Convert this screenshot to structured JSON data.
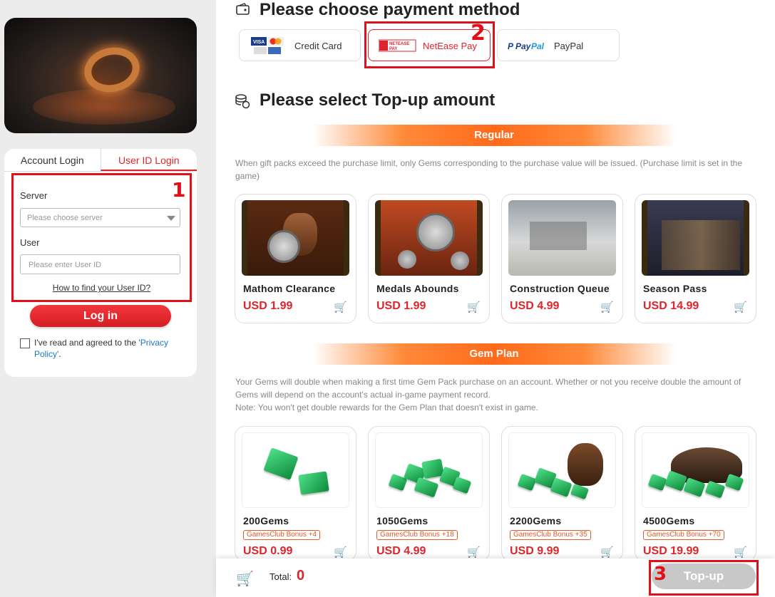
{
  "login": {
    "tabs": [
      "Account Login",
      "User ID Login"
    ],
    "server_label": "Server",
    "server_placeholder": "Please choose server",
    "user_label": "User",
    "user_placeholder": "Please enter User ID",
    "howto_link": "How to find your User ID?",
    "login_button": "Log in",
    "agree_text": "I've read and agreed to the ",
    "privacy_link": "'Privacy Policy'",
    "agree_end": "."
  },
  "annotations": {
    "n1": "1",
    "n2": "2",
    "n3": "3"
  },
  "payment": {
    "heading": "Please choose payment method",
    "methods": [
      {
        "name": "Credit Card",
        "logo": "VISA"
      },
      {
        "name": "NetEase Pay",
        "logo": "NETEASE PAY"
      },
      {
        "name": "PayPal",
        "logo": "PayPal"
      }
    ]
  },
  "topup": {
    "heading": "Please select Top-up amount",
    "regular": {
      "banner": "Regular",
      "note": "When gift packs exceed the purchase limit, only Gems corresponding to the purchase value will be issued. (Purchase limit is set in the game)",
      "items": [
        {
          "title": "Mathom Clearance",
          "price": "USD 1.99"
        },
        {
          "title": "Medals Abounds",
          "price": "USD 1.99"
        },
        {
          "title": "Construction Queue",
          "price": "USD 4.99"
        },
        {
          "title": "Season Pass",
          "price": "USD 14.99"
        }
      ]
    },
    "gem_plan": {
      "banner": "Gem Plan",
      "note_1": "Your Gems will double when making a first time Gem Pack purchase on an account. Whether or not you receive double the amount of Gems will depend on the account's actual in-game payment record.",
      "note_2": "Note: You won't get double rewards for the Gem Plan that doesn't exist in game.",
      "items": [
        {
          "title": "200Gems",
          "bonus": "GamesClub Bonus +4",
          "price": "USD 0.99"
        },
        {
          "title": "1050Gems",
          "bonus": "GamesClub Bonus +18",
          "price": "USD 4.99"
        },
        {
          "title": "2200Gems",
          "bonus": "GamesClub Bonus +35",
          "price": "USD 9.99"
        },
        {
          "title": "4500Gems",
          "bonus": "GamesClub Bonus +70",
          "price": "USD 19.99"
        }
      ]
    }
  },
  "footer": {
    "total_label": "Total:",
    "total_value": "0",
    "topup_button": "Top-up"
  },
  "colors": {
    "accent": "#e0242b",
    "orange": "#ff6a1a",
    "annotation": "#e0101a"
  }
}
